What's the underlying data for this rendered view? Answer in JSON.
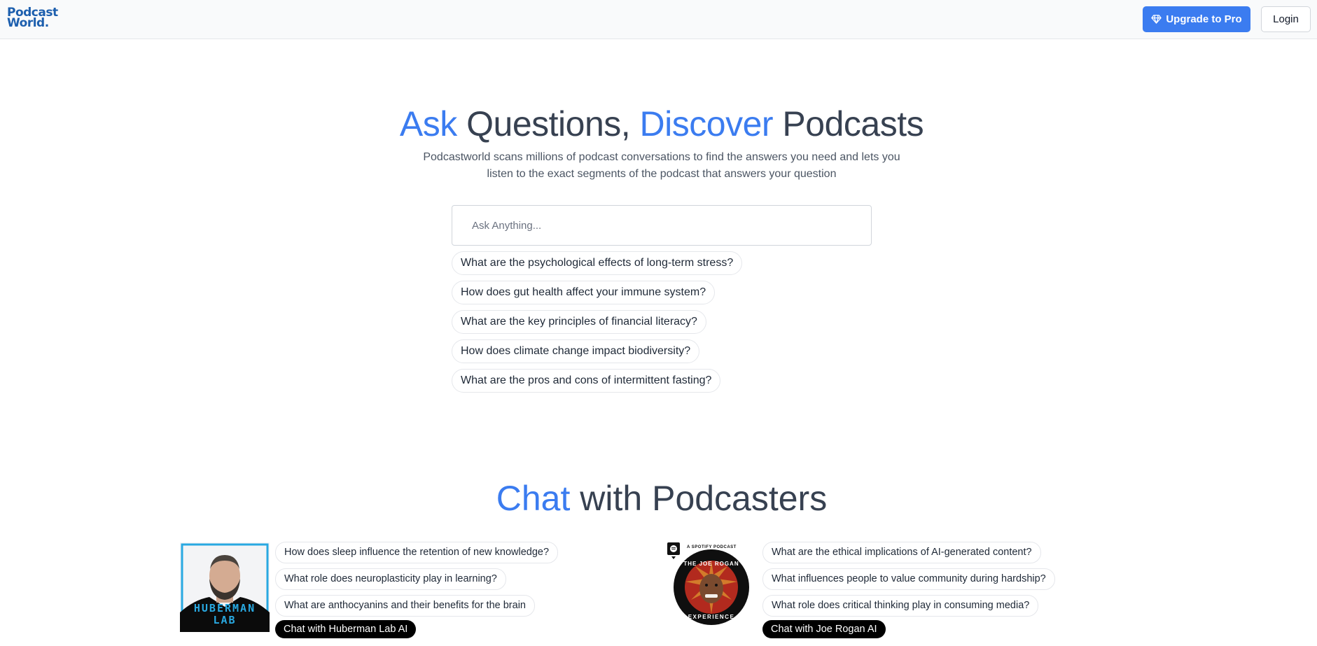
{
  "header": {
    "logo_line1": "Podcast",
    "logo_line2": "World.",
    "upgrade_label": "Upgrade to Pro",
    "login_label": "Login"
  },
  "hero": {
    "title_word1": "Ask",
    "title_word2": " Questions, ",
    "title_word3": "Discover",
    "title_word4": " Podcasts",
    "subtitle_line1": "Podcastworld scans millions of podcast conversations to find the answers you need and lets you",
    "subtitle_line2": "listen to the exact segments of the podcast that answers your question"
  },
  "search": {
    "placeholder": "Ask Anything...",
    "value": ""
  },
  "suggestions": [
    "What are the psychological effects of long-term stress?",
    "How does gut health affect your immune system?",
    "What are the key principles of financial literacy?",
    "How does climate change impact biodiversity?",
    "What are the pros and cons of intermittent fasting?"
  ],
  "podcasters_section": {
    "title_word1": "Chat",
    "title_word2": " with Podcasters"
  },
  "podcasters": [
    {
      "cover_text_line1": "HUBERMAN",
      "cover_text_line2": "LAB",
      "questions": [
        "How does sleep influence the retention of new knowledge?",
        "What role does neuroplasticity play in learning?",
        "What are anthocyanins and their benefits for the brain"
      ],
      "chat_label": "Chat with Huberman Lab AI"
    },
    {
      "cover_badge": "A SPOTIFY PODCAST",
      "cover_text_top": "THE JOE ROGAN",
      "cover_text_bottom": "EXPERIENCE",
      "questions": [
        "What are the ethical implications of AI-generated content?",
        "What influences people to value community during hardship?",
        "What role does critical thinking play in consuming media?"
      ],
      "chat_label": "Chat with Joe Rogan AI"
    }
  ],
  "colors": {
    "accent": "#3b7cf0",
    "logo": "#1d5fae",
    "text": "#374151",
    "huberman_blue": "#29a9e1"
  },
  "icons": {
    "upgrade": "diamond-icon",
    "spotify": "spotify-icon"
  }
}
